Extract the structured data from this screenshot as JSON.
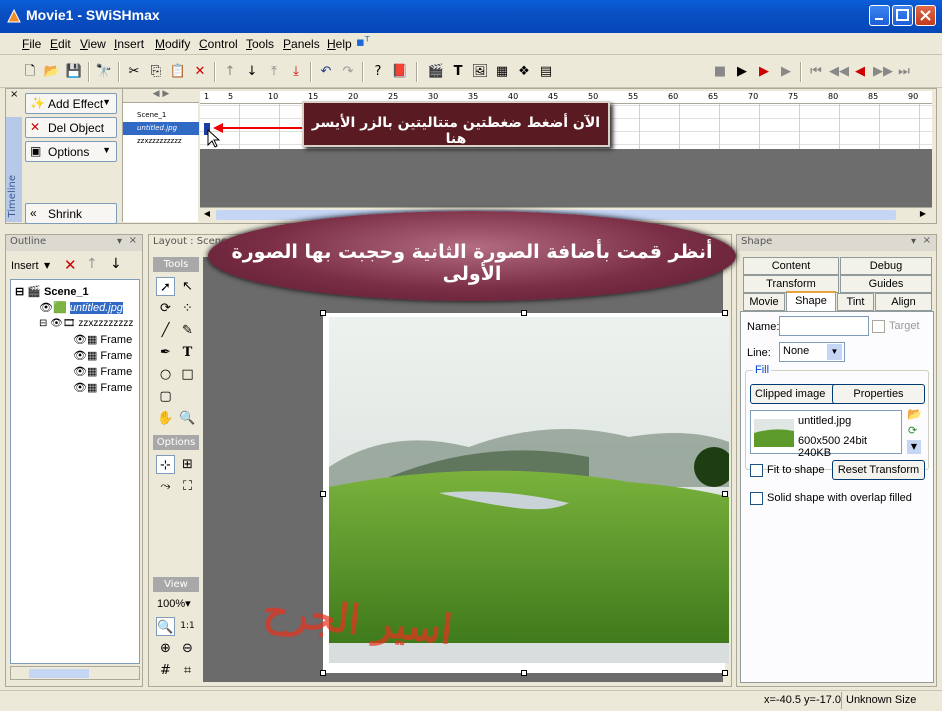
{
  "window": {
    "title": "Movie1 - SWiSHmax"
  },
  "menu": [
    "File",
    "Edit",
    "View",
    "Insert",
    "Modify",
    "Control",
    "Tools",
    "Panels",
    "Help"
  ],
  "timeline": {
    "tab_label": "Timeline",
    "buttons": {
      "add_effect": "Add Effect",
      "del_object": "Del Object",
      "options": "Options",
      "shrink": "Shrink"
    },
    "ruler_ticks": [
      "1",
      "5",
      "10",
      "15",
      "20",
      "25",
      "30",
      "35",
      "40",
      "45",
      "50",
      "55",
      "60",
      "65",
      "70",
      "75",
      "80",
      "85",
      "90"
    ],
    "rows": [
      "Scene_1",
      "untitled.jpg",
      "zzxzzzzzzzzz"
    ]
  },
  "outline": {
    "title": "Outline",
    "insert_label": "Insert",
    "tree": [
      "Scene_1",
      "untitled.jpg",
      "zzxzzzzzzzz",
      "Frame",
      "Frame",
      "Frame",
      "Frame"
    ]
  },
  "layout": {
    "title": "Layout : Scene_1",
    "tools_header": "Tools",
    "options_header": "Options",
    "view_header": "View",
    "zoom": "100%"
  },
  "shape_panel": {
    "title": "Shape",
    "tabs_row1": [
      "Content",
      "Debug"
    ],
    "tabs_row2": [
      "Transform",
      "Guides"
    ],
    "tabs_row3": [
      "Movie",
      "Shape",
      "Tint",
      "Align"
    ],
    "selected_tab": "Shape",
    "name_label": "Name:",
    "name_value": "",
    "target_label": "Target",
    "line_label": "Line:",
    "line_value": "None",
    "fill_label": "Fill",
    "fill_type": "Clipped image",
    "properties_button": "Properties",
    "image_name": "untitled.jpg",
    "image_info": "600x500 24bit 240KB",
    "fit_to_shape": "Fit to shape",
    "reset_transform": "Reset Transform",
    "solid_shape": "Solid shape with overlap filled"
  },
  "status": {
    "coords": "x=-40.5 y=-17.0",
    "size": "Unknown Size"
  },
  "annotations": {
    "top_note": "الآن أضغط ضغطتين متتاليتين بالزر الأيسر هنا",
    "big_note": "أنظر قمت بأضافة الصورة الثانية وحجبت بها الصورة الأولى",
    "watermark": "اسير الجرح"
  },
  "colors": {
    "titlebar": "#0a4fc4",
    "stage": "#6b6b6b",
    "balloon": "#7a2e45",
    "watermark": "#e8321e"
  }
}
